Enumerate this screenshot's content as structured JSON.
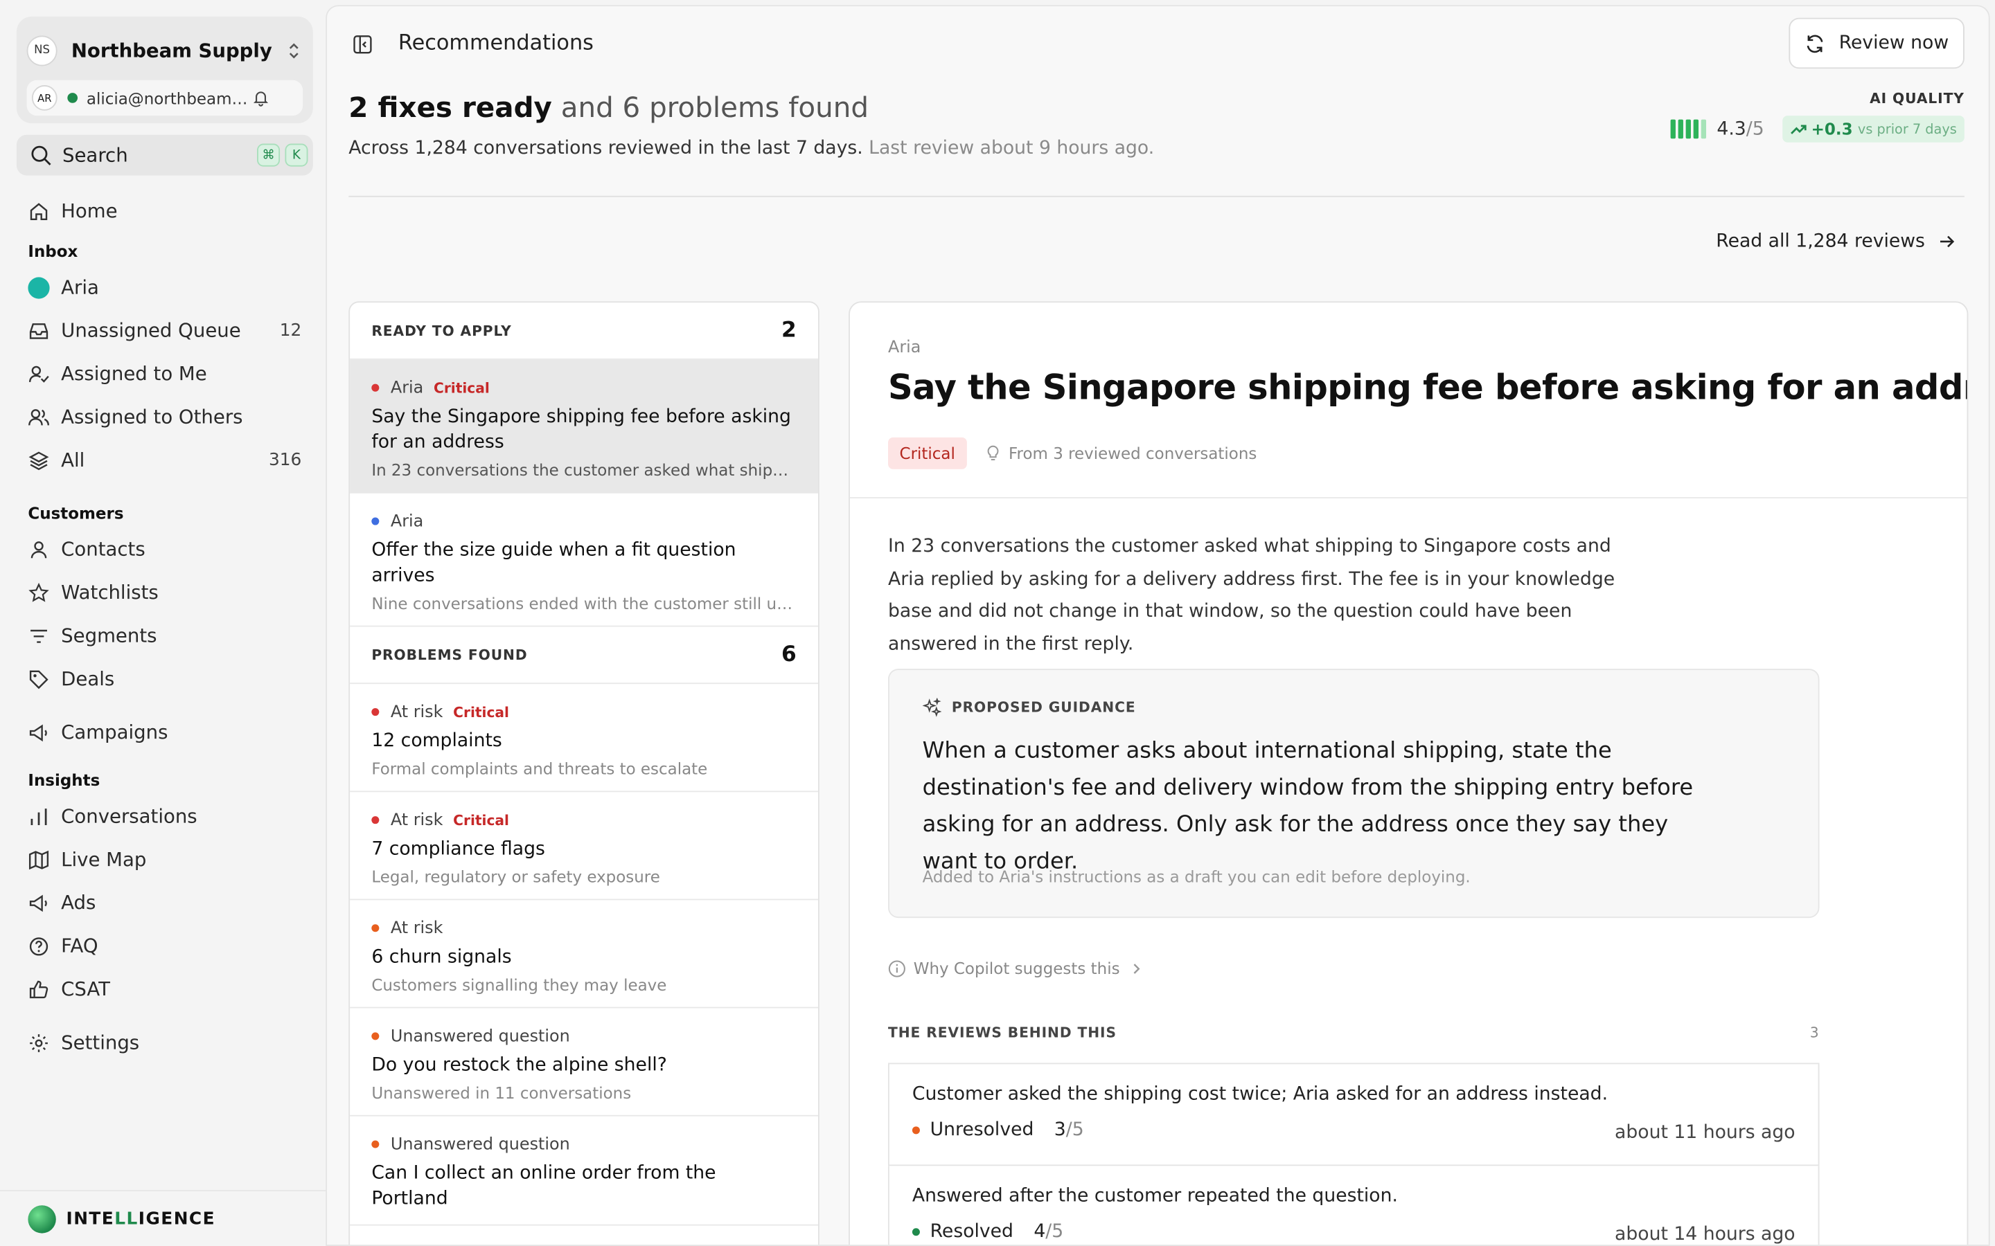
{
  "org": {
    "initials": "NS",
    "name": "Northbeam Supply"
  },
  "user": {
    "initials": "AR",
    "email": "alicia@northbeamsu..."
  },
  "search": {
    "label": "Search",
    "key1": "⌘",
    "key2": "K"
  },
  "nav": {
    "home": "Home",
    "inbox_section": "Inbox",
    "aria": "Aria",
    "unassigned": "Unassigned Queue",
    "unassigned_count": "12",
    "assigned_me": "Assigned to Me",
    "assigned_others": "Assigned to Others",
    "all": "All",
    "all_count": "316",
    "customers_section": "Customers",
    "contacts": "Contacts",
    "watchlists": "Watchlists",
    "segments": "Segments",
    "deals": "Deals",
    "campaigns": "Campaigns",
    "insights_section": "Insights",
    "conversations": "Conversations",
    "live_map": "Live Map",
    "ads": "Ads",
    "faq": "FAQ",
    "csat": "CSAT",
    "settings": "Settings"
  },
  "brand": {
    "part1": "INTE",
    "part2": "LL",
    "part3": "IGENCE"
  },
  "header": {
    "title": "Recommendations",
    "review_button": "Review now",
    "headline_bold": "2 fixes ready",
    "headline_rest": "and 6 problems found",
    "sub": "Across 1,284 conversations reviewed in the last 7 days.",
    "sub_muted": "Last review about 9 hours ago.",
    "ai_quality_label": "AI QUALITY",
    "score": "4.3",
    "score_den": "/5",
    "delta": "+0.3",
    "delta_vs": "vs prior 7 days",
    "read_all": "Read all 1,284 reviews"
  },
  "list": {
    "ready_title": "READY TO APPLY",
    "ready_count": "2",
    "problems_title": "PROBLEMS FOUND",
    "problems_count": "6",
    "ready": [
      {
        "source": "Aria",
        "tag": "Critical",
        "title": "Say the Singapore shipping fee before asking for an address",
        "desc": "In 23 conversations the customer asked what shipping t..."
      },
      {
        "source": "Aria",
        "tag": "",
        "title": "Offer the size guide when a fit question arrives",
        "desc": "Nine conversations ended with the customer still unsure..."
      }
    ],
    "problems": [
      {
        "source": "At risk",
        "tag": "Critical",
        "title": "12 complaints",
        "desc": "Formal complaints and threats to escalate"
      },
      {
        "source": "At risk",
        "tag": "Critical",
        "title": "7 compliance flags",
        "desc": "Legal, regulatory or safety exposure"
      },
      {
        "source": "At risk",
        "tag": "",
        "title": "6 churn signals",
        "desc": "Customers signalling they may leave"
      },
      {
        "source": "Unanswered question",
        "tag": "",
        "title": "Do you restock the alpine shell?",
        "desc": "Unanswered in 11 conversations"
      },
      {
        "source": "Unanswered question",
        "tag": "",
        "title": "Can I collect an online order from the Portland",
        "desc": ""
      }
    ]
  },
  "detail": {
    "agent": "Aria",
    "title": "Say the Singapore shipping fee before asking for an address",
    "badge": "Critical",
    "from": "From 3 reviewed conversations",
    "body": "In 23 conversations the customer asked what shipping to Singapore costs and Aria replied by asking for a delivery address first. The fee is in your knowledge base and did not change in that window, so the question could have been answered in the first reply.",
    "guidance_label": "PROPOSED GUIDANCE",
    "guidance": "When a customer asks about international shipping, state the destination's fee and delivery window from the shipping entry before asking for an address. Only ask for the address once they say they want to order.",
    "guidance_note": "Added to Aria's instructions as a draft you can edit before deploying.",
    "why": "Why Copilot suggests this",
    "reviews_title": "THE REVIEWS BEHIND THIS",
    "reviews_count": "3",
    "reviews": [
      {
        "text": "Customer asked the shipping cost twice; Aria asked for an address instead.",
        "status": "Unresolved",
        "score": "3",
        "den": "/5",
        "time": "about 11 hours ago"
      },
      {
        "text": "Answered after the customer repeated the question.",
        "status": "Resolved",
        "score": "4",
        "den": "/5",
        "time": "about 14 hours ago"
      }
    ]
  },
  "colors": {
    "accent": "#1f8a4c",
    "critical": "#c62828",
    "aria": "#1bb5a6"
  }
}
